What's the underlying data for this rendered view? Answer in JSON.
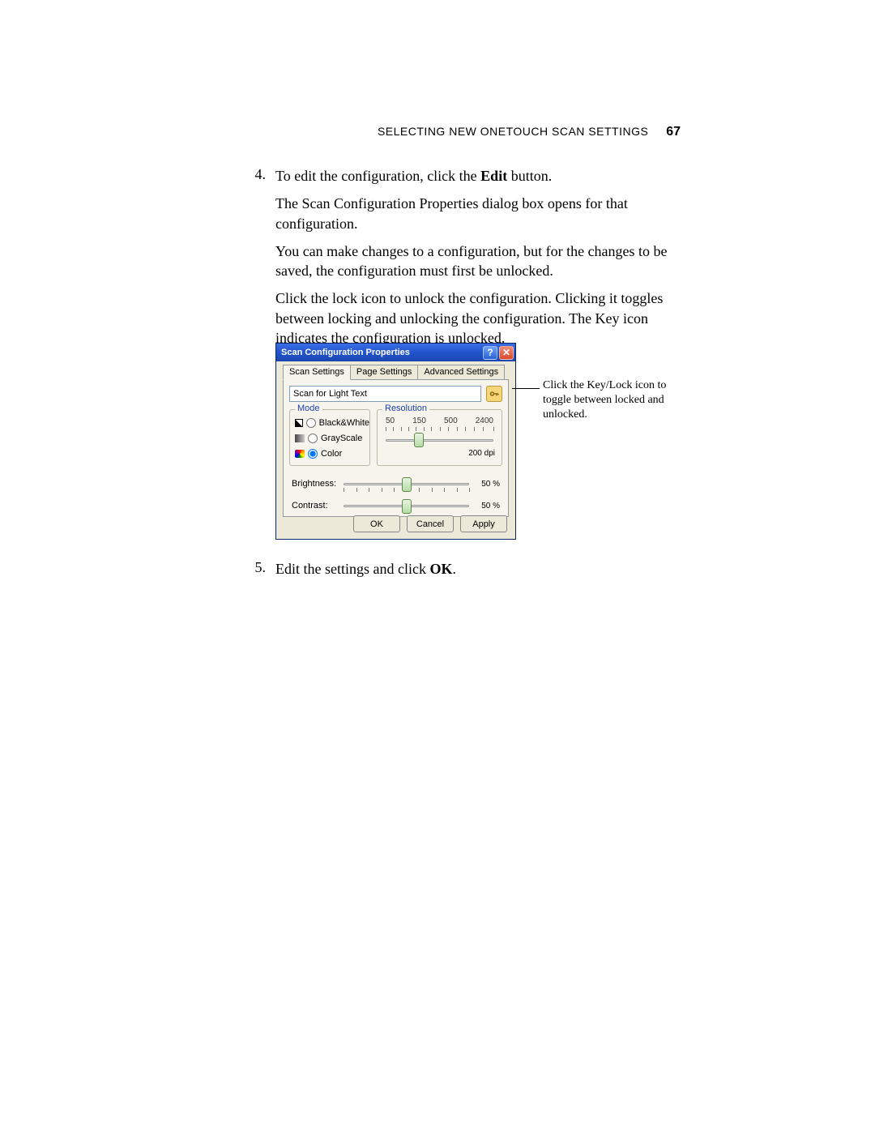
{
  "header": {
    "section_title_caps": "Selecting New OneTouch Scan Settings",
    "page_number": "67"
  },
  "steps": {
    "s4": {
      "num": "4.",
      "p1_a": "To edit the configuration, click the ",
      "p1_b": "Edit",
      "p1_c": " button.",
      "p2": "The Scan Configuration Properties dialog box opens for that configuration.",
      "p3": "You can make changes to a configuration, but for the changes to be saved, the configuration must first be unlocked.",
      "p4": "Click the lock icon to unlock the configuration. Clicking it toggles between locking and unlocking the configuration. The Key icon indicates the configuration is unlocked."
    },
    "s5": {
      "num": "5.",
      "p1_a": "Edit the settings and click ",
      "p1_b": "OK",
      "p1_c": "."
    }
  },
  "callout": "Click the Key/Lock icon to toggle between locked and unlocked.",
  "dialog": {
    "title": "Scan Configuration Properties",
    "help_symbol": "?",
    "close_symbol": "✕",
    "tabs": {
      "scan": "Scan Settings",
      "page": "Page Settings",
      "adv": "Advanced Settings"
    },
    "config_name": "Scan for Light Text",
    "mode": {
      "legend": "Mode",
      "bw": "Black&White",
      "gs": "GrayScale",
      "co": "Color"
    },
    "resolution": {
      "legend": "Resolution",
      "t1": "50",
      "t2": "150",
      "t3": "500",
      "t4": "2400",
      "readout": "200 dpi"
    },
    "brightness": {
      "label": "Brightness:",
      "value": "50 %"
    },
    "contrast": {
      "label": "Contrast:",
      "value": "50 %"
    },
    "buttons": {
      "ok": "OK",
      "cancel": "Cancel",
      "apply": "Apply"
    }
  },
  "chart_data": {
    "type": "table",
    "title": "Scan Configuration Properties — Scan Settings tab",
    "settings": [
      {
        "name": "Configuration name",
        "value": "Scan for Light Text"
      },
      {
        "name": "Mode",
        "value": "Color",
        "options": [
          "Black&White",
          "GrayScale",
          "Color"
        ]
      },
      {
        "name": "Resolution (dpi)",
        "value": 200,
        "min": 50,
        "max": 2400,
        "ticks": [
          50,
          150,
          500,
          2400
        ]
      },
      {
        "name": "Brightness (%)",
        "value": 50,
        "min": 0,
        "max": 100
      },
      {
        "name": "Contrast (%)",
        "value": 50,
        "min": 0,
        "max": 100
      }
    ]
  }
}
